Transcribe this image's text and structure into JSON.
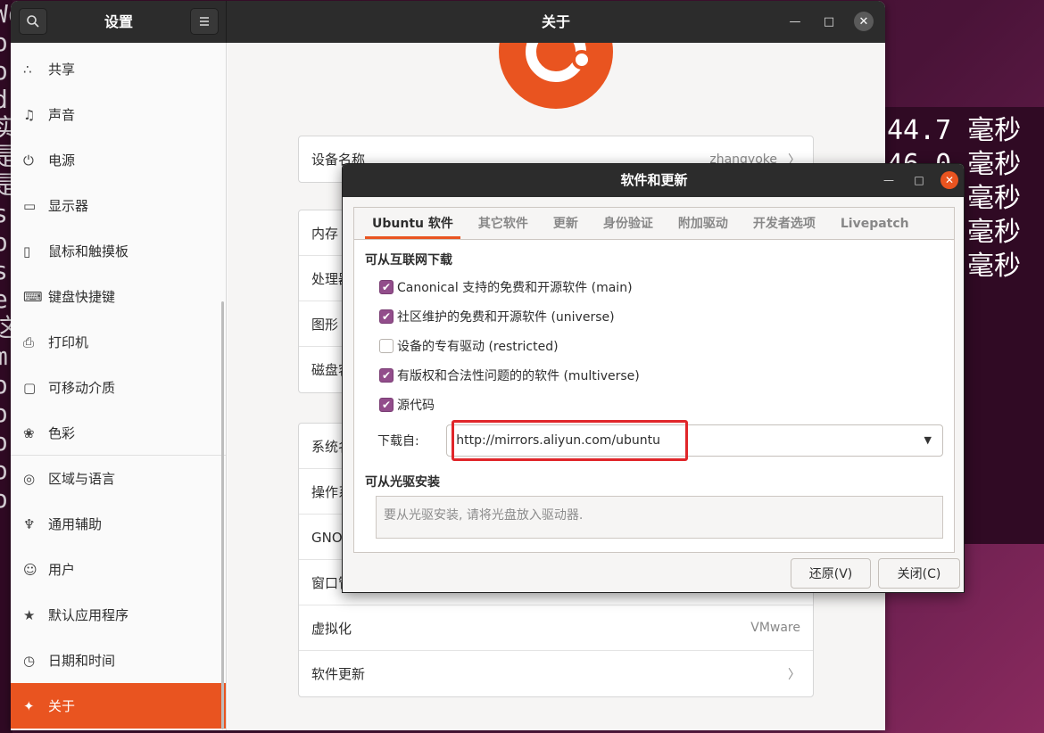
{
  "background": {
    "terminal_left_lines": [
      "Wo",
      "ok",
      "ok",
      "d",
      "实",
      "是",
      "是",
      "s",
      "ok",
      "s",
      "e",
      "这",
      "m",
      "ok",
      "ok",
      "ok",
      "ok",
      "ok"
    ],
    "terminal_right_lines": [
      "44.7 毫秒",
      "46.0 毫秒",
      "毫秒",
      "毫秒",
      "毫秒"
    ]
  },
  "settings": {
    "sidebar_title": "设置",
    "main_title": "关于",
    "sidebar_items": [
      {
        "label": "共享",
        "icon": "share-icon"
      },
      {
        "label": "声音",
        "icon": "music-note-icon"
      },
      {
        "label": "电源",
        "icon": "power-icon"
      },
      {
        "label": "显示器",
        "icon": "display-icon"
      },
      {
        "label": "鼠标和触摸板",
        "icon": "mouse-icon"
      },
      {
        "label": "键盘快捷键",
        "icon": "keyboard-icon"
      },
      {
        "label": "打印机",
        "icon": "printer-icon"
      },
      {
        "label": "可移动介质",
        "icon": "removable-media-icon"
      },
      {
        "label": "色彩",
        "icon": "color-icon"
      },
      {
        "label": "区域与语言",
        "icon": "globe-icon"
      },
      {
        "label": "通用辅助",
        "icon": "accessibility-icon"
      },
      {
        "label": "用户",
        "icon": "user-icon"
      },
      {
        "label": "默认应用程序",
        "icon": "star-icon"
      },
      {
        "label": "日期和时间",
        "icon": "clock-icon"
      },
      {
        "label": "关于",
        "icon": "sparkle-icon"
      }
    ],
    "device_name_label": "设备名称",
    "device_name_value": "zhangyoke",
    "hardware_rows": [
      "内存",
      "处理器",
      "图形",
      "磁盘容量"
    ],
    "system_rows": [
      {
        "label": "系统名称",
        "value": ""
      },
      {
        "label": "操作系统类型",
        "value": ""
      },
      {
        "label": "GNOME 版本",
        "value": ""
      },
      {
        "label": "窗口管理器",
        "value": ""
      },
      {
        "label": "虚拟化",
        "value": "VMware"
      },
      {
        "label": "软件更新",
        "value": ""
      }
    ]
  },
  "dialog": {
    "title": "软件和更新",
    "tabs": [
      "Ubuntu 软件",
      "其它软件",
      "更新",
      "身份验证",
      "附加驱动",
      "开发者选项",
      "Livepatch"
    ],
    "internet_section_title": "可从互联网下载",
    "components": [
      {
        "label": "Canonical 支持的免费和开源软件 (main)",
        "checked": true
      },
      {
        "label": "社区维护的免费和开源软件 (universe)",
        "checked": true
      },
      {
        "label": "设备的专有驱动 (restricted)",
        "checked": false
      },
      {
        "label": "有版权和合法性问题的的软件 (multiverse)",
        "checked": true
      },
      {
        "label": "源代码",
        "checked": true
      }
    ],
    "download_from_label": "下载自:",
    "download_server": "http://mirrors.aliyun.com/ubuntu",
    "cdrom_section_title": "可从光驱安装",
    "cdrom_placeholder": "要从光驱安装, 请将光盘放入驱动器.",
    "revert_button": "还原(V)",
    "close_button": "关闭(C)"
  },
  "colors": {
    "accent": "#e95420",
    "checkbox": "#924d8b",
    "highlight_box": "#e0262a",
    "header": "#2c2c2c"
  }
}
